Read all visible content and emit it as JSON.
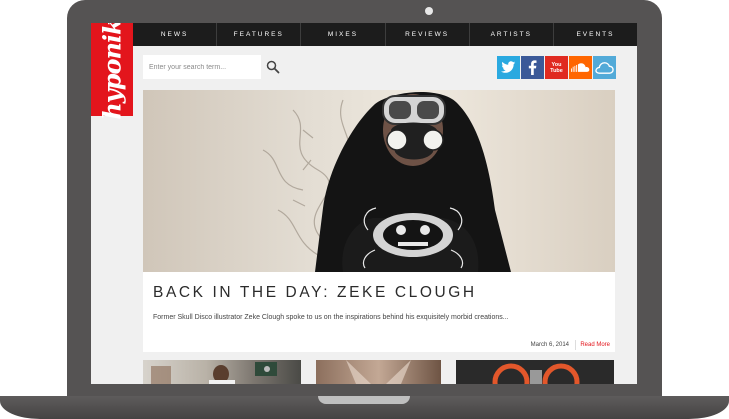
{
  "site": {
    "logo_text": "hyponik"
  },
  "nav": {
    "items": [
      "NEWS",
      "FEATURES",
      "MIXES",
      "REVIEWS",
      "ARTISTS",
      "EVENTS"
    ]
  },
  "search": {
    "placeholder": "Enter your search term..."
  },
  "social": {
    "youtube_label": "You Tube"
  },
  "article": {
    "title": "BACK IN THE DAY: ZEKE CLOUGH",
    "excerpt": "Former Skull Disco illustrator Zeke Clough spoke to us on the inspirations behind his exquisitely morbid creations...",
    "date": "March 6, 2014",
    "read_more": "Read More"
  },
  "colors": {
    "brand_red": "#e3151c",
    "nav_bg": "#1c1c1c",
    "twitter": "#2aa9e0",
    "facebook": "#3b5998",
    "youtube": "#e02a20",
    "soundcloud": "#ff6600",
    "mixcloud": "#52aad8"
  },
  "icons": {
    "search": "search-icon",
    "twitter": "twitter-icon",
    "facebook": "facebook-icon",
    "youtube": "youtube-icon",
    "soundcloud": "soundcloud-icon",
    "mixcloud": "mixcloud-icon"
  }
}
